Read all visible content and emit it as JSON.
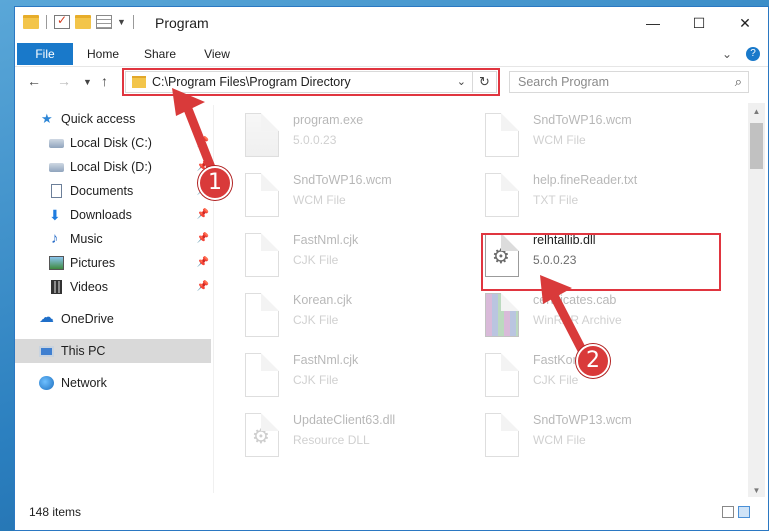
{
  "window": {
    "title": "Program"
  },
  "ribbon": {
    "tabs": [
      {
        "label": "File"
      },
      {
        "label": "Home"
      },
      {
        "label": "Share"
      },
      {
        "label": "View"
      }
    ]
  },
  "address": {
    "path": "C:\\Program Files\\Program Directory"
  },
  "search": {
    "placeholder": "Search Program"
  },
  "sidebar": {
    "items": [
      {
        "label": "Quick access",
        "icon": "star-icon"
      },
      {
        "label": "Local Disk (C:)",
        "icon": "disk-icon"
      },
      {
        "label": "Local Disk (D:)",
        "icon": "disk-icon"
      },
      {
        "label": "Documents",
        "icon": "documents-icon"
      },
      {
        "label": "Downloads",
        "icon": "downloads-icon"
      },
      {
        "label": "Music",
        "icon": "music-icon"
      },
      {
        "label": "Pictures",
        "icon": "pictures-icon"
      },
      {
        "label": "Videos",
        "icon": "videos-icon"
      },
      {
        "label": "OneDrive",
        "icon": "cloud-icon"
      },
      {
        "label": "This PC",
        "icon": "computer-icon",
        "selected": true
      },
      {
        "label": "Network",
        "icon": "network-icon"
      }
    ]
  },
  "files": [
    {
      "name": "program.exe",
      "type": "5.0.0.23"
    },
    {
      "name": "SndToWP16.wcm",
      "type": "WCM File"
    },
    {
      "name": "SndToWP16.wcm",
      "type": "WCM File"
    },
    {
      "name": "help.fineReader.txt",
      "type": "TXT File"
    },
    {
      "name": "FastNml.cjk",
      "type": "CJK File"
    },
    {
      "name": "relhtallib.dll",
      "type": "5.0.0.23"
    },
    {
      "name": "Korean.cjk",
      "type": "CJK File"
    },
    {
      "name": "certificates.cab",
      "type": "WinRAR Archive"
    },
    {
      "name": "FastNml.cjk",
      "type": "CJK File"
    },
    {
      "name": "FastKor.cjk",
      "type": "CJK File"
    },
    {
      "name": "UpdateClient63.dll",
      "type": "Resource DLL"
    },
    {
      "name": "SndToWP13.wcm",
      "type": "WCM File"
    }
  ],
  "status": {
    "item_count": "148 items"
  },
  "annotations": {
    "step1": "1",
    "step2": "2"
  },
  "colors": {
    "accent": "#1979ca",
    "highlight": "#e0353f"
  }
}
